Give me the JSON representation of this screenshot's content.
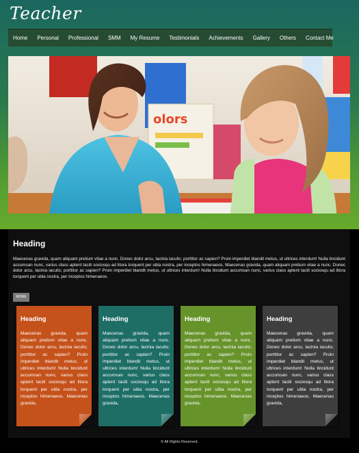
{
  "site": {
    "logo": "Teacher"
  },
  "nav": {
    "items": [
      "Home",
      "Personal",
      "Professional",
      "SMM",
      "My Resume",
      "Testimonials",
      "Achievements",
      "Gallery",
      "Others",
      "Contact Me"
    ]
  },
  "hero": {
    "sign_text": "olors"
  },
  "main": {
    "heading": "Heading",
    "paragraph": "Maecenas gravida, quam aliquam pretium vitae a nunc. Donec dolor arcu, lacinia iaculis; porttitor ac sapien? Proin imperdiet blandit metus, ut ultrices interdum! Nulla tincidunt accumsan nunc, varius class aptent taciti sociosqu ad litora torquent per ubla nostra, per inceptos himenaeos. Maecenas gravida, quam aliquam pretium vitae a nunc. Donec dolor arcu, lacinia iaculis; porttitor ac sapien? Proin imperdiet blandit metus, ut ultrices interdum! Nulla tincidunt accumsan nunc, varius class aptent taciti sociosqu ad litora torquent per ubla nostra, per inceptos himenaeos.",
    "more_label": "MORE"
  },
  "cards": [
    {
      "title": "Heading",
      "text": "Maecenas gravida, quam aliquam pretium vitae a nunc. Donec dolor arcu, lacinia iaculis; porttitor ac sapien? Proin imperdiet blandit metus, ut ultrices interdum! Nulla tincidunt accumsan nunc, varius class aptent taciti sociosqu ad litora torquent per ubla nostra, per inceptos himenaeos. Maecenas gravida,",
      "color": "#c5521b"
    },
    {
      "title": "Heading",
      "text": "Maecenas gravida, quam aliquam pretium vitae a nunc. Donec dolor arcu, lacinia iaculis; porttitor ac sapien? Proin imperdiet blandit metus, ut ultrices interdum! Nulla tincidunt accumsan nunc, varius class aptent taciti sociosqu ad litora torquent per ubla nostra, per inceptos himenaeos. Maecenas gravida,",
      "color": "#1e6e66"
    },
    {
      "title": "Heading",
      "text": "Maecenas gravida, quam aliquam pretium vitae a nunc. Donec dolor arcu, lacinia iaculis; porttitor ac sapien? Proin imperdiet blandit metus, ut ultrices interdum! Nulla tincidunt accumsan nunc, varius class aptent taciti sociosqu ad litora torquent per ubla nostra, per inceptos himenaeos. Maecenas gravida,",
      "color": "#67932b"
    },
    {
      "title": "Heading",
      "text": "Maecenas gravida, quam aliquam pretium vitae a nunc. Donec dolor arcu, lacinia iaculis; porttitor ac sapien? Proin imperdiet blandit metus, ut ultrices interdum! Nulla tincidunt accumsan nunc, varius class aptent taciti sociosqu ad litora torquent per ubla nostra, per inceptos himenaeos. Maecenas gravida,",
      "color": "#3e3e3e"
    }
  ],
  "footer": {
    "text": "© All Rights Reserved."
  }
}
